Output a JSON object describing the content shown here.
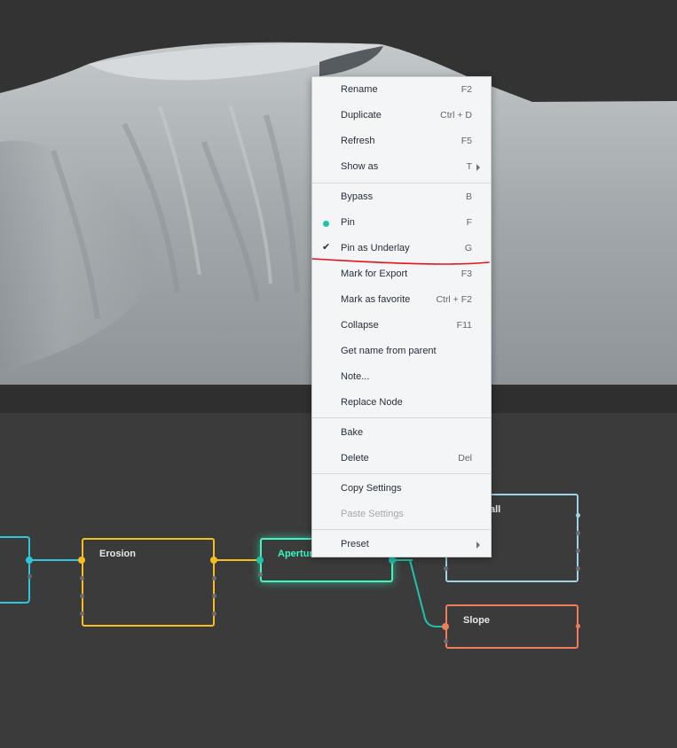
{
  "colors": {
    "viewport_bg": "#333333",
    "graph_bg": "#3b3b3b",
    "accent_teal": "#1fc3a9",
    "cyan": "#2ec6d6",
    "yellow": "#f5bd1f",
    "mint": "#3ff5c2",
    "lightblue": "#9fd2e5",
    "orange": "#f07d5a",
    "annotation_red": "#e3141b"
  },
  "context_menu": {
    "items": [
      {
        "label": "Rename",
        "shortcut": "F2"
      },
      {
        "label": "Duplicate",
        "shortcut": "Ctrl + D"
      },
      {
        "label": "Refresh",
        "shortcut": "F5"
      },
      {
        "label": "Show as",
        "shortcut": "T",
        "submenu": true
      },
      {
        "label": "Bypass",
        "shortcut": "B"
      },
      {
        "label": "Pin",
        "shortcut": "F",
        "icon": "status-dot-icon"
      },
      {
        "label": "Pin as Underlay",
        "shortcut": "G",
        "icon": "checkmark-icon",
        "checked": true
      },
      {
        "label": "Mark for Export",
        "shortcut": "F3"
      },
      {
        "label": "Mark as favorite",
        "shortcut": "Ctrl + F2"
      },
      {
        "label": "Collapse",
        "shortcut": "F11"
      },
      {
        "label": "Get name from parent"
      },
      {
        "label": "Note..."
      },
      {
        "label": "Replace Node"
      },
      {
        "label": "Bake"
      },
      {
        "label": "Delete",
        "shortcut": "Del"
      },
      {
        "label": "Copy Settings"
      },
      {
        "label": "Paste Settings",
        "disabled": true
      },
      {
        "label": "Preset",
        "submenu": true
      }
    ]
  },
  "nodes": {
    "erosion": {
      "title": "Erosion"
    },
    "aperture": {
      "title": "Apertur"
    },
    "thermal": {
      "title": "all"
    },
    "slope": {
      "title": "Slope"
    }
  }
}
